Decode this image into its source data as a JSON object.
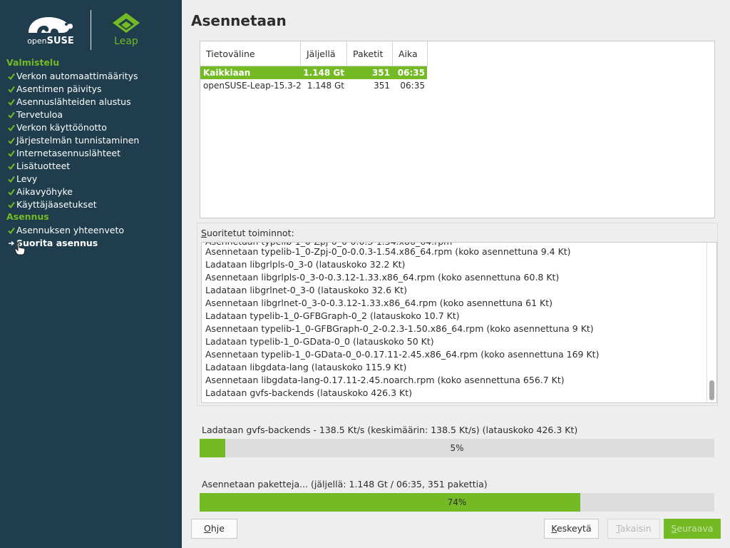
{
  "colors": {
    "sidebar_bg": "#1f3d4c",
    "accent": "#73ba25",
    "page_bg": "#eeeeee"
  },
  "branding": {
    "opensuse_prefix": "open",
    "opensuse_suffix": "SUSE",
    "leap": "Leap"
  },
  "sidebar": {
    "sections": [
      {
        "title": "Valmistelu",
        "items": [
          {
            "label": "Verkon automaattimääritys",
            "icon": "check-icon"
          },
          {
            "label": "Asentimen päivitys",
            "icon": "check-icon"
          },
          {
            "label": "Asennuslähteiden alustus",
            "icon": "check-icon"
          },
          {
            "label": "Tervetuloa",
            "icon": "check-icon"
          },
          {
            "label": "Verkon käyttöönotto",
            "icon": "check-icon"
          },
          {
            "label": "Järjestelmän tunnistaminen",
            "icon": "check-icon"
          },
          {
            "label": "Internetasennuslähteet",
            "icon": "check-icon"
          },
          {
            "label": "Lisätuotteet",
            "icon": "check-icon"
          },
          {
            "label": "Levy",
            "icon": "check-icon"
          },
          {
            "label": "Aikavyöhyke",
            "icon": "check-icon"
          },
          {
            "label": "Käyttäjäasetukset",
            "icon": "check-icon"
          }
        ]
      },
      {
        "title": "Asennus",
        "items": [
          {
            "label": "Asennuksen yhteenveto",
            "icon": "check-icon"
          },
          {
            "label": "Suorita asennus",
            "icon": "arrow-right-icon",
            "current": true
          }
        ]
      }
    ]
  },
  "main": {
    "title": "Asennetaan",
    "media_table": {
      "columns": [
        "Tietoväline",
        "Jäljellä",
        "Paketit",
        "Aika"
      ],
      "rows": [
        {
          "cells": [
            "Kaikkiaan",
            "1.148 Gt",
            "351",
            "06:35"
          ],
          "selected": true
        },
        {
          "cells": [
            "openSUSE-Leap-15.3-2",
            "1.148 Gt",
            "351",
            "06:35"
          ],
          "selected": false
        }
      ]
    },
    "actions": {
      "label_first_letter": "S",
      "label_rest": "uoritetut toiminnot:",
      "lines": [
        "Asennetaan typelib-1_0-Zpj-0_0-0.0.3-1.54.x86_64.rpm (koko asennettuna 9.4 Kt)",
        "Ladataan libgrlpls-0_3-0 (latauskoko 32.2 Kt)",
        "Asennetaan libgrlpls-0_3-0-0.3.12-1.33.x86_64.rpm (koko asennettuna 60.8 Kt)",
        "Ladataan libgrlnet-0_3-0 (latauskoko 32.6 Kt)",
        "Asennetaan libgrlnet-0_3-0-0.3.12-1.33.x86_64.rpm (koko asennettuna 61 Kt)",
        "Ladataan typelib-1_0-GFBGraph-0_2 (latauskoko 10.7 Kt)",
        "Asennetaan typelib-1_0-GFBGraph-0_2-0.2.3-1.50.x86_64.rpm (koko asennettuna 9 Kt)",
        "Ladataan typelib-1_0-GData-0_0 (latauskoko 50 Kt)",
        "Asennetaan typelib-1_0-GData-0_0-0.17.11-2.45.x86_64.rpm (koko asennettuna 169 Kt)",
        "Ladataan libgdata-lang (latauskoko 115.9 Kt)",
        "Asennetaan libgdata-lang-0.17.11-2.45.noarch.rpm (koko asennettuna 656.7 Kt)",
        "Ladataan gvfs-backends (latauskoko 426.3 Kt)"
      ]
    },
    "download_progress": {
      "label": "Ladataan gvfs-backends - 138.5 Kt/s (keskimäärin: 138.5 Kt/s) (latauskoko 426.3 Kt)",
      "percent": 5,
      "text": "5%"
    },
    "install_progress": {
      "label": "Asennetaan paketteja... (jäljellä: 1.148 Gt / 06:35, 351 pakettia)",
      "percent": 74,
      "text": "74%"
    }
  },
  "buttons": {
    "help": {
      "first": "O",
      "rest": "hje"
    },
    "abort": {
      "first": "K",
      "rest": "eskeytä"
    },
    "back": {
      "first": "T",
      "rest": "akaisin"
    },
    "next": {
      "first": "S",
      "rest": "euraava"
    }
  }
}
